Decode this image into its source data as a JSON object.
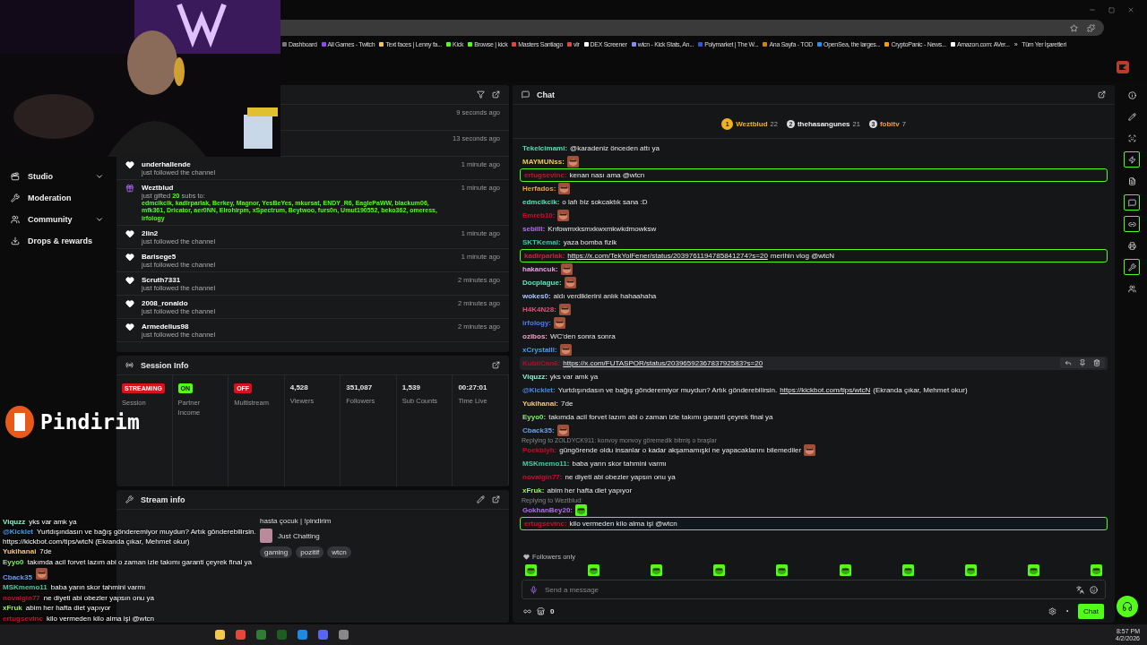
{
  "browser": {
    "bookmarks": [
      "Dashboard",
      "All Games - Twitch",
      "Text faces | Lenny fa...",
      "Kick",
      "Browse | kick",
      "Masters Santiago",
      "vlr",
      "DEX Screener",
      "wtcn - Kick Stats, An...",
      "Polymarket | The W...",
      "Ana Sayfa - TOD",
      "OpenSea, the larges...",
      "CryptoPanic - News...",
      "Amazon.com: AVer..."
    ],
    "more": "»",
    "all_bookmarks": "Tüm Yer İşaretleri"
  },
  "sidebar": {
    "items": [
      {
        "label": "Studio",
        "expandable": true
      },
      {
        "label": "Moderation",
        "expandable": false
      },
      {
        "label": "Community",
        "expandable": true
      },
      {
        "label": "Drops & rewards",
        "expandable": false
      }
    ]
  },
  "activity": {
    "items": [
      {
        "kind": "hidden",
        "time": "9 seconds ago"
      },
      {
        "kind": "hidden",
        "time": "13 seconds ago"
      },
      {
        "kind": "follow",
        "user": "underhallende",
        "text": "just followed the channel",
        "time": "1 minute ago"
      },
      {
        "kind": "gift",
        "user": "Weztblud",
        "text": "just gifted **20** subs to:",
        "recipients": "edmcikcik, kadirparlak, Berkey, Magnor, YesBeYes, mkursat, ENDY_R6, EaglePaWW, blackum06, mfk361, Dricator, aer0NN, Elrohirpm, xSpectrum, Beytwoo, furs0n, Umut190552, beko362, omeress, irfology",
        "time": "1 minute ago"
      },
      {
        "kind": "follow",
        "user": "2lin2",
        "text": "just followed the channel",
        "time": "1 minute ago"
      },
      {
        "kind": "follow",
        "user": "Barisege5",
        "text": "just followed the channel",
        "time": "1 minute ago"
      },
      {
        "kind": "follow",
        "user": "Scruth7331",
        "text": "just followed the channel",
        "time": "2 minutes ago"
      },
      {
        "kind": "follow",
        "user": "2008_ronaldo",
        "text": "just followed the channel",
        "time": "2 minutes ago"
      },
      {
        "kind": "follow",
        "user": "Armedelius98",
        "text": "just followed the channel",
        "time": "2 minutes ago"
      }
    ]
  },
  "session_info": {
    "title": "Session Info",
    "cards": [
      {
        "kind": "status",
        "badge": "STREAMING",
        "color": "#d3141b",
        "label": "Session"
      },
      {
        "kind": "status",
        "badge": "ON",
        "color": "#53fc18",
        "label": "Partner Income"
      },
      {
        "kind": "status",
        "badge": "OFF",
        "color": "#d3141b",
        "label": "Multistream"
      },
      {
        "kind": "stat",
        "value": "4,528",
        "label": "Viewers"
      },
      {
        "kind": "stat",
        "value": "351,087",
        "label": "Followers"
      },
      {
        "kind": "stat",
        "value": "1,539",
        "label": "Sub Counts"
      },
      {
        "kind": "stat",
        "value": "00:27:01",
        "label": "Time Live"
      }
    ]
  },
  "stream_info": {
    "title": "Stream info",
    "stream_title": "hasta çocuk | !pindirim",
    "category": "Just Chatting",
    "tags": [
      "gaming",
      "pozitif",
      "wtcn"
    ]
  },
  "chat": {
    "title": "Chat",
    "leaderboard": [
      {
        "rank": "1",
        "user": "Weztblud",
        "count": "22"
      },
      {
        "rank": "2",
        "user": "thehasangunes",
        "count": "21"
      },
      {
        "rank": "3",
        "user": "fobitv",
        "count": "7"
      }
    ],
    "messages": [
      {
        "user": "Tekelcimami:",
        "color": "#52e0b0",
        "text": "@karadeniz önceden attı ya"
      },
      {
        "user": "MAYMUNss:",
        "color": "#f2c94c",
        "emote": true
      },
      {
        "user": "ertugsevinc:",
        "color": "#c8102e",
        "text": "kenan nası ama @wtcn",
        "highlighted": true
      },
      {
        "user": "Herfados:",
        "color": "#f29e38",
        "emote": true
      },
      {
        "user": "edmcikcik:",
        "color": "#52e0b0",
        "text": "o lafı biz sokcaktık sana :D"
      },
      {
        "user": "Emreb10:",
        "color": "#c8102e",
        "emote": true
      },
      {
        "user": "sebilll:",
        "color": "#b06cf5",
        "text": "Knfowmxksmxkwxmkwkdmowksw"
      },
      {
        "user": "SKTKemal:",
        "color": "#3fc8a8",
        "text": "yaza bomba fizik"
      },
      {
        "user": "kadirparlak:",
        "color": "#d0203e",
        "link": "https://x.com/TekYolFener/status/2039761194785841274?s=20",
        "after": "merihin vlog @wtcN",
        "highlighted": true
      },
      {
        "user": "hakancuk:",
        "color": "#e8a0e0",
        "emote": true
      },
      {
        "user": "Docplague:",
        "color": "#5ae8b8",
        "emote": true
      },
      {
        "user": "wokes0:",
        "color": "#a8c8ff",
        "text": "aldı verdiklerini anlık hahaahaha"
      },
      {
        "user": "H4K4N28:",
        "color": "#e0507a",
        "emote": true
      },
      {
        "user": "irfology:",
        "color": "#4a7cf0",
        "emote": true
      },
      {
        "user": "ozibos:",
        "color": "#f0a0c8",
        "text": "WC'den sonra sonra"
      },
      {
        "user": "xCrystalll:",
        "color": "#4a9cf0",
        "emote": true
      },
      {
        "user": "KubiiCan6:",
        "color": "#b80c28",
        "link": "https://x.com/FUTASPOR/status/2039659236783792583?s=20",
        "hovered": true
      },
      {
        "user": "Viquzz:",
        "color": "#8ef0d0",
        "text": "yks var amk ya"
      },
      {
        "user": "@Kicklet:",
        "color": "#4a8ce8",
        "text": "Yurtdışındasın ve bağış gönderemiyor muydun? Artık gönderebilirsin.",
        "link": "https://kickbot.com/tips/wtcN",
        "after": "(Ekranda çıkar, Mehmet okur)"
      },
      {
        "user": "Yukihanai:",
        "color": "#f2c97a",
        "text": "7de"
      },
      {
        "user": "Eyyo0:",
        "color": "#7cf05a",
        "text": "takımda acil forvet lazım abi o zaman izle takımı garanti çeyrek final ya"
      },
      {
        "user": "Cback35:",
        "color": "#6aa0f0",
        "emote": true
      },
      {
        "user": "Poekblyh:",
        "color": "#c0102a",
        "reply": "Replying to ZOLDYCK911: konvoy monvoy göremedik bitmiş o braşlar",
        "text": "güngörende oldu insanlar o kadar akşamamışki ne yapacaklarını bilemediler",
        "emote": true
      },
      {
        "user": "MSKmemo11:",
        "color": "#3ad0a0",
        "text": "baba yarın skor tahmini varmı"
      },
      {
        "user": "novalgin77:",
        "color": "#c81030",
        "text": "ne diyeti abi obezler yapsın onu ya"
      },
      {
        "user": "xFruk:",
        "color": "#9cf05a",
        "text": "abim her hafta diet yapıyor"
      },
      {
        "user": "GokhanBey20:",
        "color": "#b06cf5",
        "reply": "Replying to Weztblud:",
        "emote": true
      },
      {
        "user": "ertugsevinc:",
        "color": "#c8102e",
        "text": "kilo vermeden kilo alma işi @wtcn",
        "highlighted": true
      }
    ],
    "followers_only": "Followers only",
    "input": {
      "placeholder": "Send a message"
    },
    "points": "0",
    "send_button": "Chat"
  },
  "overlay": {
    "brand": "Pindirim",
    "chat": [
      {
        "user": "Viquzz",
        "color": "#8ef0d1",
        "text": "yks var amk ya"
      },
      {
        "user": "@Kicklet",
        "color": "#4a9cf1",
        "text": "Yurtdışındasın ve bağış gönderemiyor muydun? Artık gönderebilirsin. https://kickbot.com/tips/wtcN (Ekranda çıkar, Mehmet okur)"
      },
      {
        "user": "Yukihanai",
        "color": "#f2c97b",
        "text": "7de"
      },
      {
        "user": "Eyyo0",
        "color": "#7cf05b",
        "text": "takımda acil forvet lazım abi o zaman izle takımı garanti çeyrek final ya"
      },
      {
        "user": "Cback35",
        "color": "#6aa0f1",
        "emote": true
      },
      {
        "user": "MSKmemo11",
        "color": "#3ad0a1",
        "text": "baba yarın skor tahmini varmı"
      },
      {
        "user": "novalgin77",
        "color": "#c8102f",
        "text": "ne diyeti abi obezler yapsın onu ya"
      },
      {
        "user": "xFruk",
        "color": "#9cf05b",
        "text": "abim her hafta diet yapıyor"
      },
      {
        "user": "ertugsevinc",
        "color": "#c81030",
        "text": "kilo vermeden kilo alma işi @wtcn"
      }
    ]
  },
  "taskbar": {
    "time": "8:57 PM",
    "date": "4/2/2026"
  }
}
